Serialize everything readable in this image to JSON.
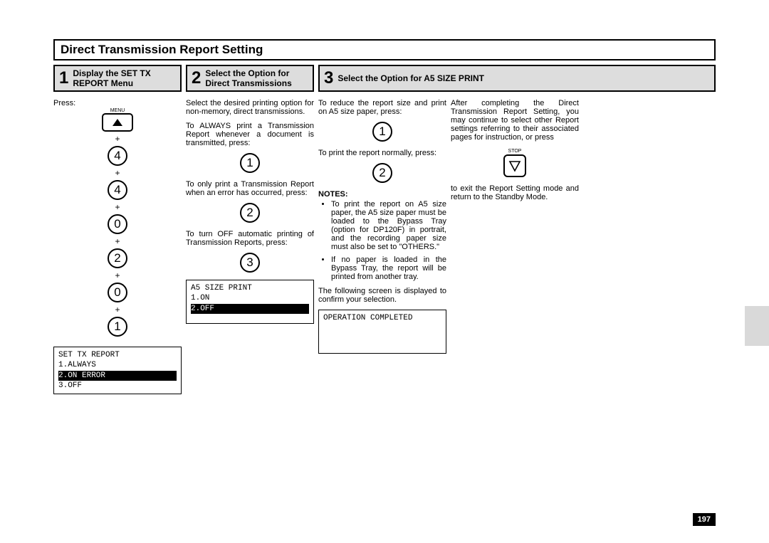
{
  "title": "Direct Transmission Report Setting",
  "steps": {
    "s1": {
      "num": "1",
      "label": "Display the SET TX REPORT Menu"
    },
    "s2": {
      "num": "2",
      "label": "Select the Option for Direct Transmissions"
    },
    "s3": {
      "num": "3",
      "label": "Select the Option for A5 SIZE PRINT"
    }
  },
  "col1": {
    "press": "Press:",
    "menu": "MENU",
    "seq": [
      "4",
      "4",
      "0",
      "2",
      "0",
      "1"
    ],
    "lcd": {
      "l1": "SET TX REPORT",
      "l2": "1.ALWAYS",
      "l3": "2.ON ERROR",
      "l4": "3.OFF"
    }
  },
  "col2": {
    "p1": "Select the desired printing option for non-memory, direct transmissions.",
    "p2": "To ALWAYS print a Transmission Report whenever a document is transmitted, press:",
    "btn1": "1",
    "p3": "To only print a Transmission Report when an error has occurred, press:",
    "btn2": "2",
    "p4": "To turn OFF automatic printing of Transmission Reports, press:",
    "btn3": "3",
    "lcd": {
      "l1": "A5 SIZE PRINT",
      "l2": "1.ON",
      "l3": "2.OFF",
      "l4": ""
    }
  },
  "col3": {
    "p1": "To reduce the report size and print on A5 size paper, press:",
    "btn1": "1",
    "p2": "To print the report normally, press:",
    "btn2": "2",
    "notes_h": "NOTES:",
    "note1": "To print the report on A5 size paper, the A5 size paper must be loaded to the Bypass Tray (option for DP120F) in portrait, and the recording paper size must also be set to \"OTHERS.\"",
    "note2": "If no paper is loaded in the Bypass Tray, the report will be printed from another tray.",
    "p3": "The following screen is displayed to confirm your selection.",
    "lcd": {
      "l1": "OPERATION COMPLETED",
      "l2": "",
      "l3": "",
      "l4": ""
    }
  },
  "col4": {
    "p1": "After completing the Direct Transmission Report Setting, you may continue to select other Report settings referring to their associated pages for instruction, or press",
    "stop": "STOP",
    "p2": "to exit the Report Setting mode and return to the Standby Mode."
  },
  "page": "197"
}
